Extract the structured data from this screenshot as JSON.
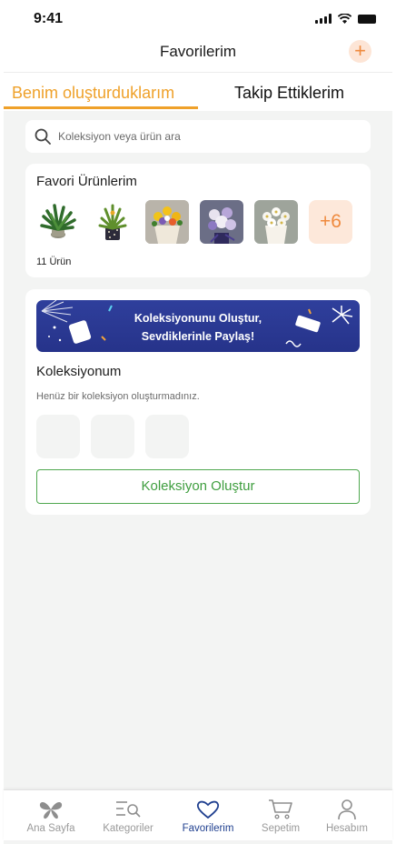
{
  "status_bar": {
    "time": "9:41"
  },
  "header": {
    "title": "Favorilerim",
    "add_symbol": "+"
  },
  "tabs": [
    {
      "label": "Benim oluşturduklarım",
      "active": true
    },
    {
      "label": "Takip Ettiklerim",
      "active": false
    }
  ],
  "search": {
    "placeholder": "Koleksiyon veya ürün ara",
    "value": ""
  },
  "favorites": {
    "title": "Favori Ürünlerim",
    "thumbnails": [
      "plant-thumbnail",
      "plant-thumbnail",
      "sunflower-bouquet-thumbnail",
      "purple-bouquet-thumbnail",
      "white-daisy-bouquet-thumbnail"
    ],
    "more_label": "+6",
    "count_label": "11 Ürün"
  },
  "collections": {
    "banner_line1": "Koleksiyonunu Oluştur,",
    "banner_line2": "Sevdiklerinle Paylaş!",
    "title": "Koleksiyonum",
    "empty_text": "Henüz bir koleksiyon oluşturmadınız.",
    "create_button": "Koleksiyon Oluştur"
  },
  "bottom_nav": [
    {
      "label": "Ana Sayfa",
      "icon": "home-flower-icon",
      "active": false
    },
    {
      "label": "Kategoriler",
      "icon": "categories-search-icon",
      "active": false
    },
    {
      "label": "Favorilerim",
      "icon": "heart-icon",
      "active": true
    },
    {
      "label": "Sepetim",
      "icon": "cart-icon",
      "active": false
    },
    {
      "label": "Hesabım",
      "icon": "user-icon",
      "active": false
    }
  ],
  "colors": {
    "accent_orange": "#efa12a",
    "green": "#3f9e3f",
    "nav_active": "#1f3f8f",
    "banner_blue": "#2c3a96"
  }
}
